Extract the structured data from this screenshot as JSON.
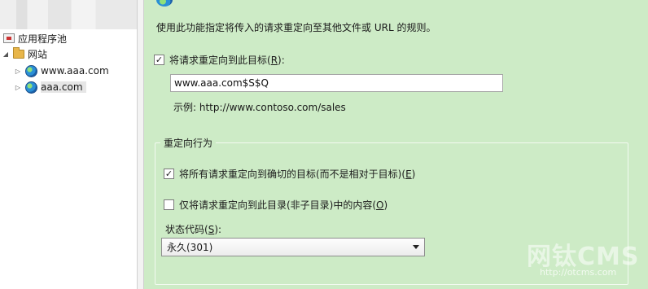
{
  "tree": {
    "app_pools_label": "应用程序池",
    "sites_label": "网站",
    "sites": [
      {
        "label": "www.aaa.com",
        "selected": false
      },
      {
        "label": "aaa.com",
        "selected": true
      }
    ]
  },
  "redirect": {
    "description": "使用此功能指定将传入的请求重定向至其他文件或 URL 的规则。",
    "enable": {
      "label_prefix": "将请求重定向到此目标(",
      "accel": "R",
      "label_suffix": "):",
      "checked": true
    },
    "destination_value": "www.aaa.com$S$Q",
    "example": "示例: http://www.contoso.com/sales"
  },
  "behavior": {
    "group_title": "重定向行为",
    "exact": {
      "label_prefix": "将所有请求重定向到确切的目标(而不是相对于目标)(",
      "accel": "E",
      "label_suffix": ")",
      "checked": true
    },
    "only_dir": {
      "label_prefix": "仅将请求重定向到此目录(非子目录)中的内容(",
      "accel": "O",
      "label_suffix": ")",
      "checked": false
    },
    "status": {
      "label_prefix": "状态代码(",
      "accel": "S",
      "label_suffix": "):",
      "selected": "永久(301)"
    }
  },
  "watermark": {
    "title": "网钛CMS",
    "url": "http://otcms.com"
  },
  "colors": {
    "content_bg": "#cdebc6",
    "tree_bg": "#ffffff"
  }
}
